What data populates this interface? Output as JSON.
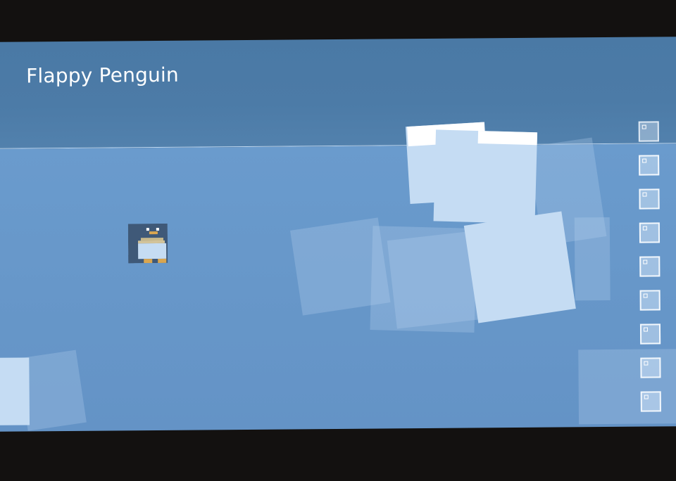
{
  "game": {
    "title": "Flappy Penguin"
  },
  "sprites": {
    "player": "penguin",
    "obstacles": "ice-blocks"
  },
  "sidebar": {
    "items": [
      {
        "name": "level-1",
        "active": true
      },
      {
        "name": "level-2",
        "active": false
      },
      {
        "name": "level-3",
        "active": false
      },
      {
        "name": "level-4",
        "active": false
      },
      {
        "name": "level-5",
        "active": false
      },
      {
        "name": "level-6",
        "active": false
      },
      {
        "name": "level-7",
        "active": false
      },
      {
        "name": "level-8",
        "active": false
      },
      {
        "name": "level-9",
        "active": false
      }
    ]
  },
  "colors": {
    "sky": "#4a79a5",
    "water": "#6797c9",
    "ice": "#c5dcf3",
    "ice_top": "#ffffff",
    "letterbox": "#131110"
  }
}
